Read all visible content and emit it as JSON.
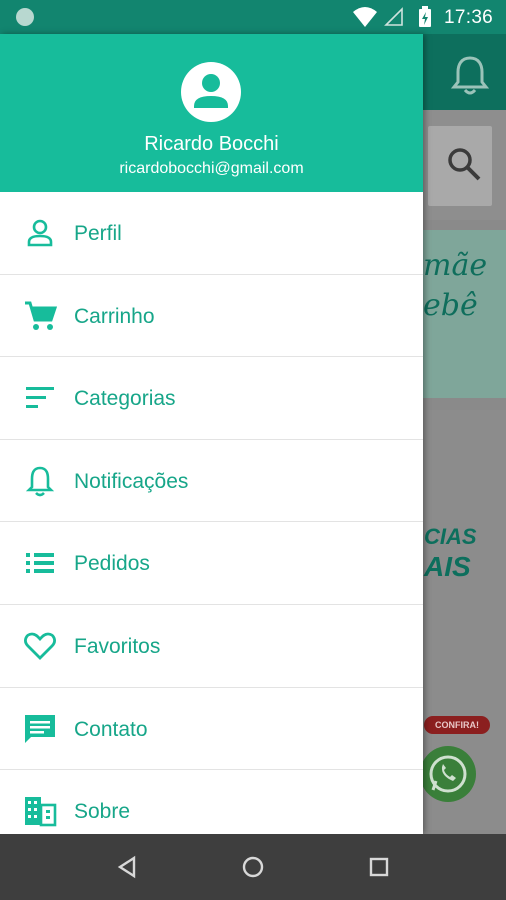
{
  "status_bar": {
    "time": "17:36"
  },
  "drawer": {
    "user": {
      "name": "Ricardo Bocchi",
      "email": "ricardobocchi@gmail.com"
    },
    "items": [
      {
        "label": "Perfil",
        "icon": "person-icon"
      },
      {
        "label": "Carrinho",
        "icon": "cart-icon"
      },
      {
        "label": "Categorias",
        "icon": "sort-icon"
      },
      {
        "label": "Notificações",
        "icon": "bell-icon"
      },
      {
        "label": "Pedidos",
        "icon": "list-icon"
      },
      {
        "label": "Favoritos",
        "icon": "heart-icon"
      },
      {
        "label": "Contato",
        "icon": "chat-icon"
      },
      {
        "label": "Sobre",
        "icon": "building-icon"
      }
    ]
  },
  "background": {
    "banner_text_1": "mãe",
    "banner_text_2": "ebê",
    "promo_text_1": "CIAS",
    "promo_text_2": "AIS",
    "confira_label": "CONFIRA!"
  },
  "colors": {
    "accent": "#17bc9b",
    "accent_text": "#17a689",
    "status_bar": "#12856f",
    "toolbar": "#0d6f5d"
  }
}
